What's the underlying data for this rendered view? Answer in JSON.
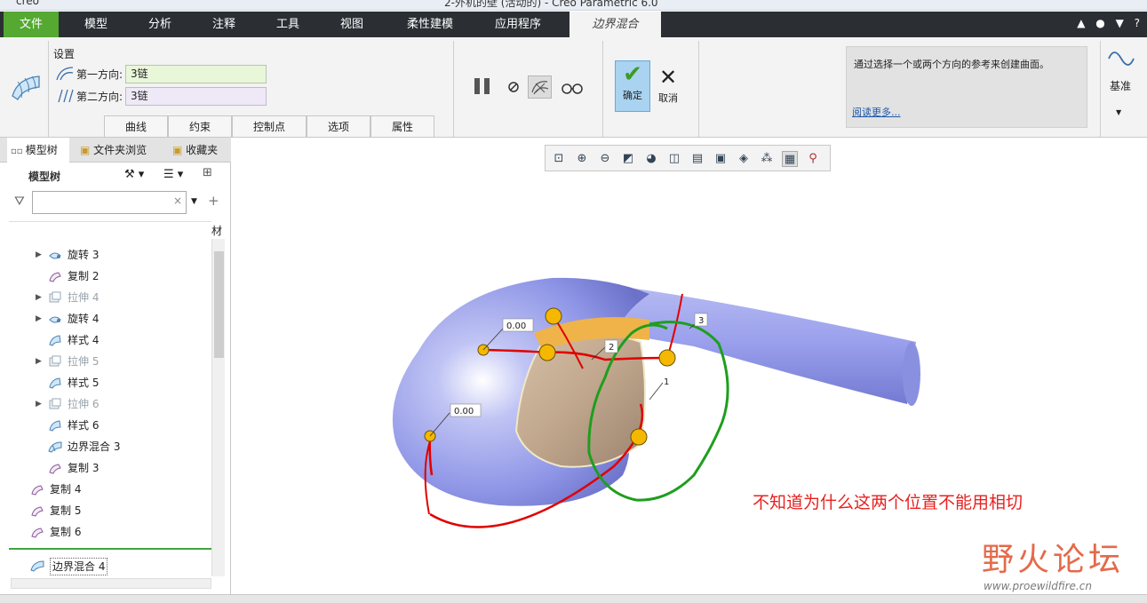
{
  "titlebar": {
    "app": "creo",
    "title": "2-外机的壁 (活动的) - Creo Parametric 6.0"
  },
  "menu": {
    "items": [
      "文件",
      "模型",
      "分析",
      "注释",
      "工具",
      "视图",
      "柔性建模",
      "应用程序",
      "边界混合"
    ],
    "active": "边界混合"
  },
  "ribbon": {
    "settings_label": "设置",
    "first_dir_label": "第一方向:",
    "first_dir_value": "3链",
    "second_dir_label": "第二方向:",
    "second_dir_value": "3链",
    "tabs": [
      "曲线",
      "约束",
      "控制点",
      "选项",
      "属性"
    ],
    "ok_label": "确定",
    "cancel_label": "取消",
    "help_text": "通过选择一个或两个方向的参考来创建曲面。",
    "help_more": "阅读更多...",
    "base_label": "基准"
  },
  "left_panel": {
    "tabs": [
      "模型树",
      "文件夹浏览",
      "收藏夹"
    ],
    "title": "模型树",
    "column_header": "材",
    "tree": [
      {
        "label": "旋转 3",
        "expandable": true,
        "dim": false,
        "indent": 1,
        "icon": "revolve-icon"
      },
      {
        "label": "复制 2",
        "expandable": false,
        "dim": false,
        "indent": 1,
        "icon": "copy-icon"
      },
      {
        "label": "拉伸 4",
        "expandable": true,
        "dim": true,
        "indent": 1,
        "icon": "extrude-icon"
      },
      {
        "label": "旋转 4",
        "expandable": true,
        "dim": false,
        "indent": 1,
        "icon": "revolve-icon"
      },
      {
        "label": "样式 4",
        "expandable": false,
        "dim": false,
        "indent": 1,
        "icon": "style-icon"
      },
      {
        "label": "拉伸 5",
        "expandable": true,
        "dim": true,
        "indent": 1,
        "icon": "extrude-icon"
      },
      {
        "label": "样式 5",
        "expandable": false,
        "dim": false,
        "indent": 1,
        "icon": "style-icon"
      },
      {
        "label": "拉伸 6",
        "expandable": true,
        "dim": true,
        "indent": 1,
        "icon": "extrude-icon"
      },
      {
        "label": "样式 6",
        "expandable": false,
        "dim": false,
        "indent": 1,
        "icon": "style-icon"
      },
      {
        "label": "边界混合 3",
        "expandable": false,
        "dim": false,
        "indent": 1,
        "icon": "boundary-blend-icon"
      },
      {
        "label": "复制 3",
        "expandable": false,
        "dim": false,
        "indent": 1,
        "icon": "copy-icon"
      },
      {
        "label": "复制 4",
        "expandable": false,
        "dim": false,
        "indent": 0,
        "icon": "copy-icon"
      },
      {
        "label": "复制 5",
        "expandable": false,
        "dim": false,
        "indent": 0,
        "icon": "copy-icon"
      },
      {
        "label": "复制 6",
        "expandable": false,
        "dim": false,
        "indent": 0,
        "icon": "copy-icon"
      }
    ],
    "current_feature": "边界混合 4"
  },
  "viewport": {
    "dim_labels": [
      "0.00",
      "0.00",
      "1",
      "2",
      "3"
    ],
    "annotation": "不知道为什么这两个位置不能用相切",
    "watermark": "野火论坛",
    "watermark_url": "www.proewildfire.cn"
  },
  "colors": {
    "menubar": "#2b2f33",
    "file_tab": "#55a832",
    "surface": "#8f96e8",
    "curve_red": "#e00000",
    "curve_green": "#1e9e1e",
    "handle_yellow": "#f5b800"
  }
}
